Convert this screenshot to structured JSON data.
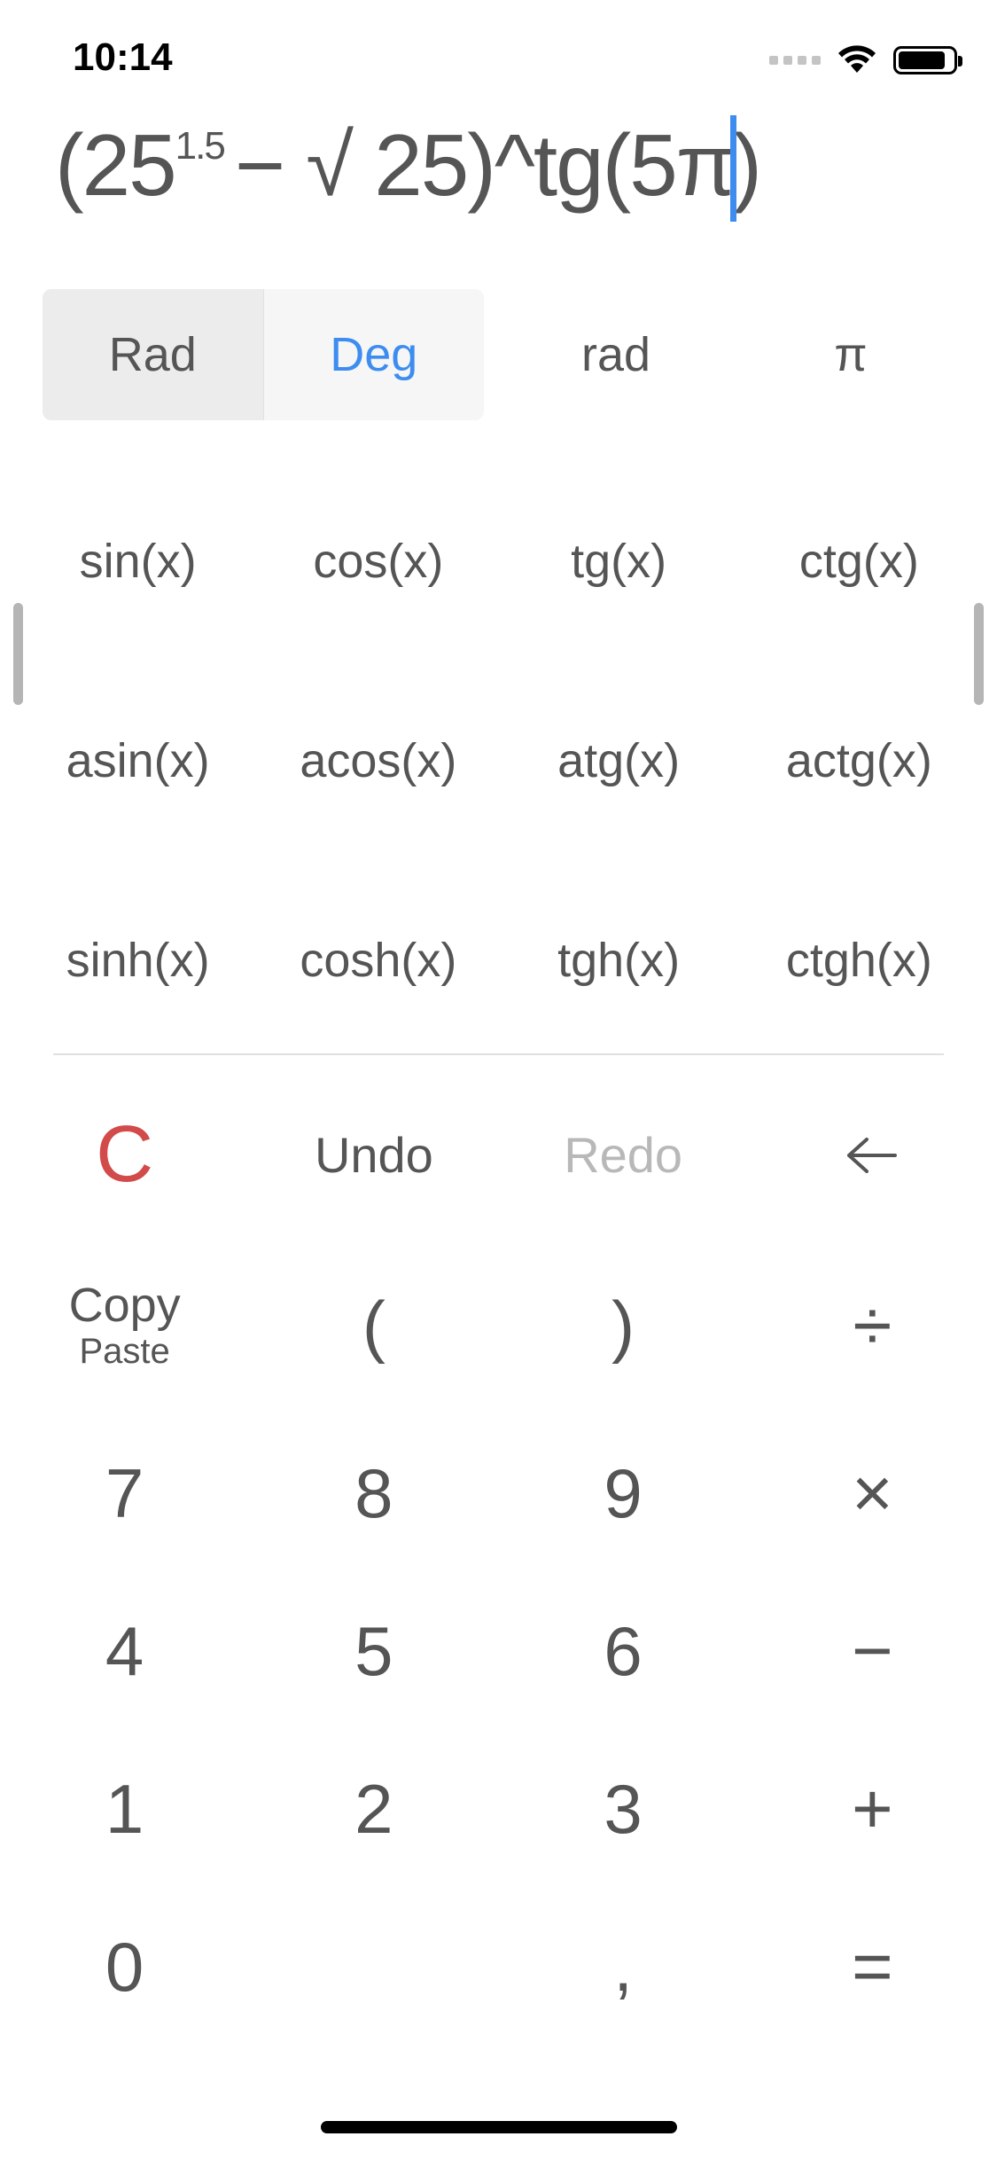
{
  "status_bar": {
    "time": "10:14"
  },
  "expression": {
    "part_before_sup": "(25",
    "superscript": "1.5",
    "part_after_sup": "− √ 25)^tg(5π",
    "closing": ")"
  },
  "modes": {
    "rad_mode": "Rad",
    "deg_mode": "Deg",
    "rad_unit": "rad",
    "pi": "π",
    "accent_color": "#3d8df0"
  },
  "functions": [
    [
      "sin(x)",
      "cos(x)",
      "tg(x)",
      "ctg(x)"
    ],
    [
      "asin(x)",
      "acos(x)",
      "atg(x)",
      "actg(x)"
    ],
    [
      "sinh(x)",
      "cosh(x)",
      "tgh(x)",
      "ctgh(x)"
    ]
  ],
  "controls": {
    "clear": "C",
    "undo": "Undo",
    "redo": "Redo",
    "backspace": "←",
    "clear_color": "#d24a4a"
  },
  "keypad": {
    "copy": "Copy",
    "paste": "Paste",
    "open_paren": "(",
    "close_paren": ")",
    "divide": "÷",
    "seven": "7",
    "eight": "8",
    "nine": "9",
    "multiply": "×",
    "four": "4",
    "five": "5",
    "six": "6",
    "minus": "−",
    "one": "1",
    "two": "2",
    "three": "3",
    "plus": "+",
    "zero": "0",
    "comma": ",",
    "equals": "="
  }
}
